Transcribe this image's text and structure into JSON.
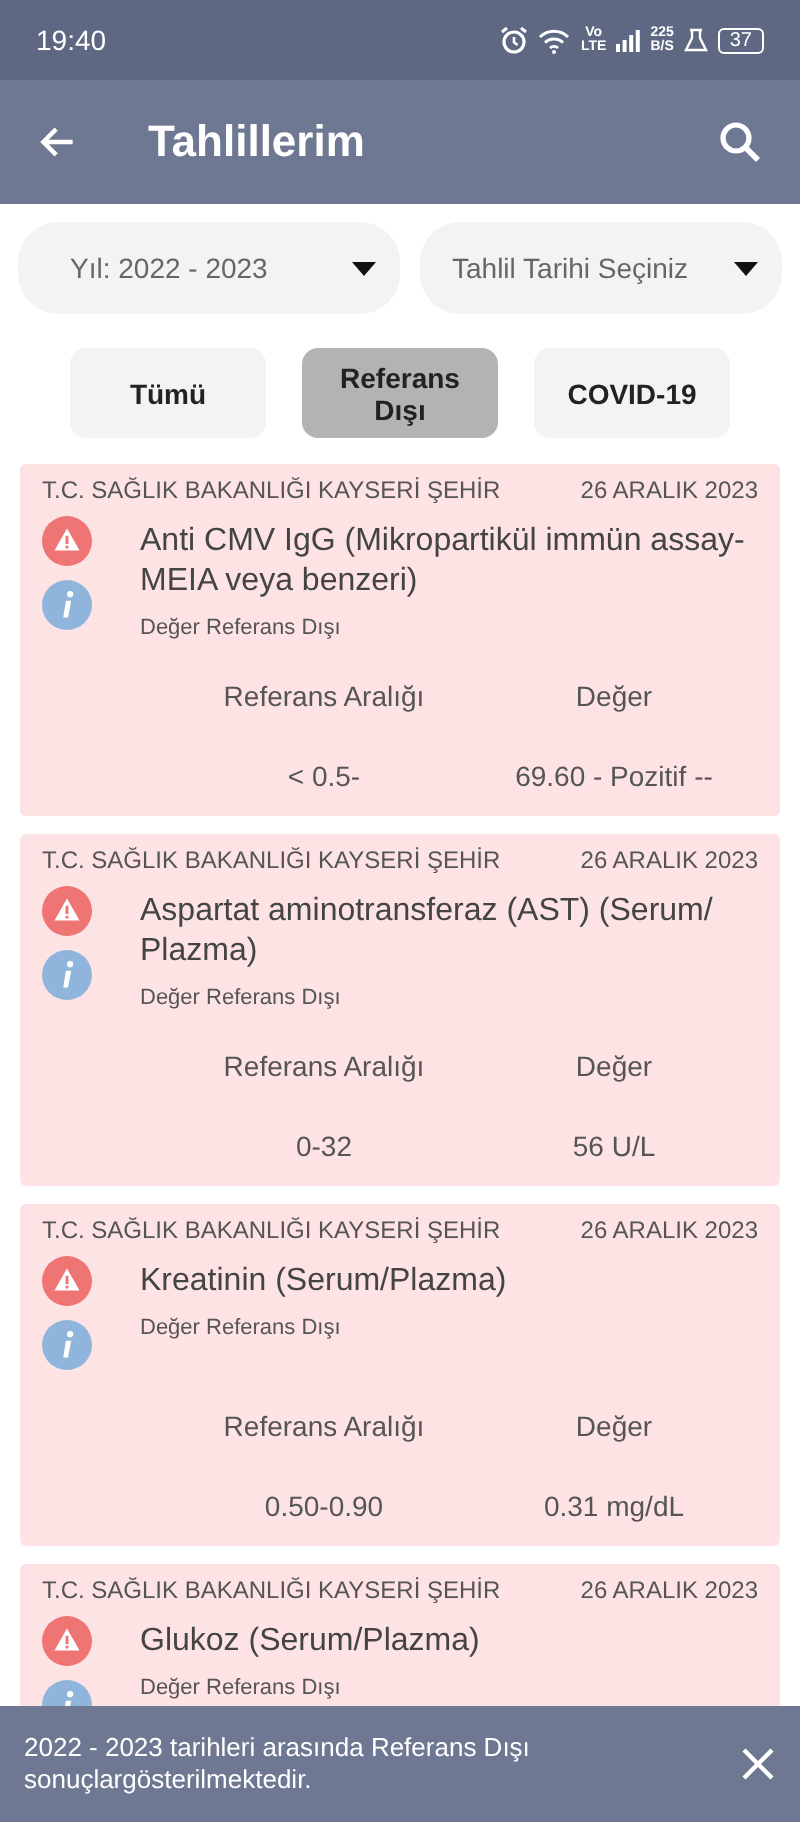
{
  "status_bar": {
    "time": "19:40",
    "network_label": [
      "Vo",
      "LTE"
    ],
    "speed": [
      "225",
      "B/S"
    ],
    "battery": "37"
  },
  "app_bar": {
    "title": "Tahlillerim"
  },
  "filters": [
    {
      "value": "Yıl: 2022 - 2023"
    },
    {
      "value": "Tahlil Tarihi Seçiniz"
    }
  ],
  "tabs": [
    {
      "label": "Tümü",
      "selected": false
    },
    {
      "label": "Referans Dışı",
      "selected": true
    },
    {
      "label": "COVID-19",
      "selected": false
    }
  ],
  "results": [
    {
      "hospital": "T.C. SAĞLIK BAKANLIĞI KAYSERİ ŞEHİR",
      "date": "26 ARALIK 2023",
      "test": "Anti CMV IgG (Mikropartikül immün assay-MEIA veya benzeri)",
      "status": "Değer Referans Dışı",
      "range_label": "Referans Aralığı",
      "value_label": "Değer",
      "range": "< 0.5-",
      "value": "69.60 - Pozitif --"
    },
    {
      "hospital": "T.C. SAĞLIK BAKANLIĞI KAYSERİ ŞEHİR",
      "date": "26 ARALIK 2023",
      "test": "Aspartat aminotransferaz (AST) (Serum/ Plazma)",
      "status": "Değer Referans Dışı",
      "range_label": "Referans Aralığı",
      "value_label": "Değer",
      "range": "0-32",
      "value": "56 U/L"
    },
    {
      "hospital": "T.C. SAĞLIK BAKANLIĞI KAYSERİ ŞEHİR",
      "date": "26 ARALIK 2023",
      "test": "Kreatinin (Serum/Plazma)",
      "status": "Değer Referans Dışı",
      "range_label": "Referans Aralığı",
      "value_label": "Değer",
      "range": "0.50-0.90",
      "value": "0.31 mg/dL"
    },
    {
      "hospital": "T.C. SAĞLIK BAKANLIĞI KAYSERİ ŞEHİR",
      "date": "26 ARALIK 2023",
      "test": "Glukoz (Serum/Plazma)",
      "status": "Değer Referans Dışı"
    }
  ],
  "snackbar": {
    "message": "2022 - 2023 tarihleri arasında Referans Dışı sonuçlargösterilmektedir."
  }
}
